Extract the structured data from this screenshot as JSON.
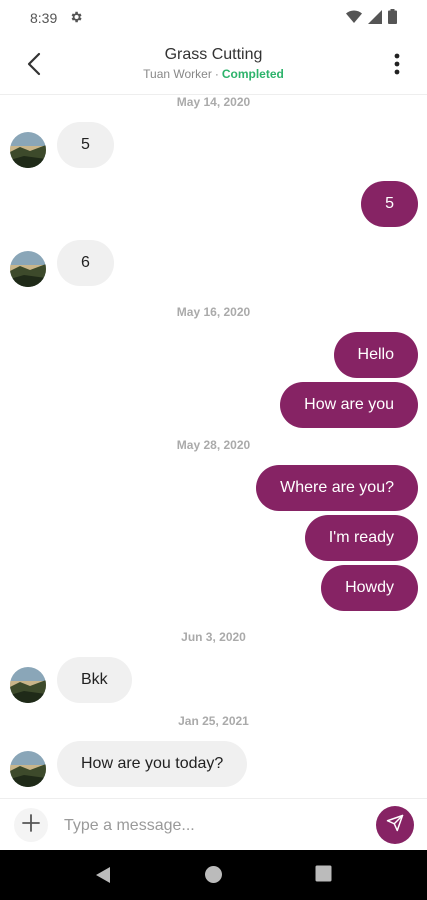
{
  "status_bar": {
    "time": "8:39"
  },
  "header": {
    "title": "Grass Cutting",
    "worker": "Tuan Worker",
    "separator": "·",
    "status": "Completed"
  },
  "colors": {
    "accent": "#862364",
    "status_green": "#2db36b",
    "incoming_bubble": "#f0f0f0"
  },
  "messages": {
    "date_1": "May 14, 2020",
    "msg_1": "5",
    "msg_2": "5",
    "msg_3": "6",
    "date_2": "May 16, 2020",
    "msg_4": "Hello",
    "msg_5": "How are you",
    "date_3": "May 28, 2020",
    "msg_6": "Where are you?",
    "msg_7": "I'm ready",
    "msg_8": "Howdy",
    "date_4": "Jun 3, 2020",
    "msg_9": "Bkk",
    "date_5": "Jan 25, 2021",
    "msg_10": "How are you today?"
  },
  "composer": {
    "placeholder": "Type a message..."
  },
  "icons": {
    "settings": "gear-icon",
    "wifi": "wifi-icon",
    "signal": "signal-icon",
    "battery": "battery-icon",
    "back": "chevron-left-icon",
    "menu": "more-vertical-icon",
    "add": "plus-icon",
    "send": "send-icon",
    "nav_back": "triangle-back-icon",
    "nav_home": "circle-home-icon",
    "nav_recents": "square-recents-icon"
  }
}
